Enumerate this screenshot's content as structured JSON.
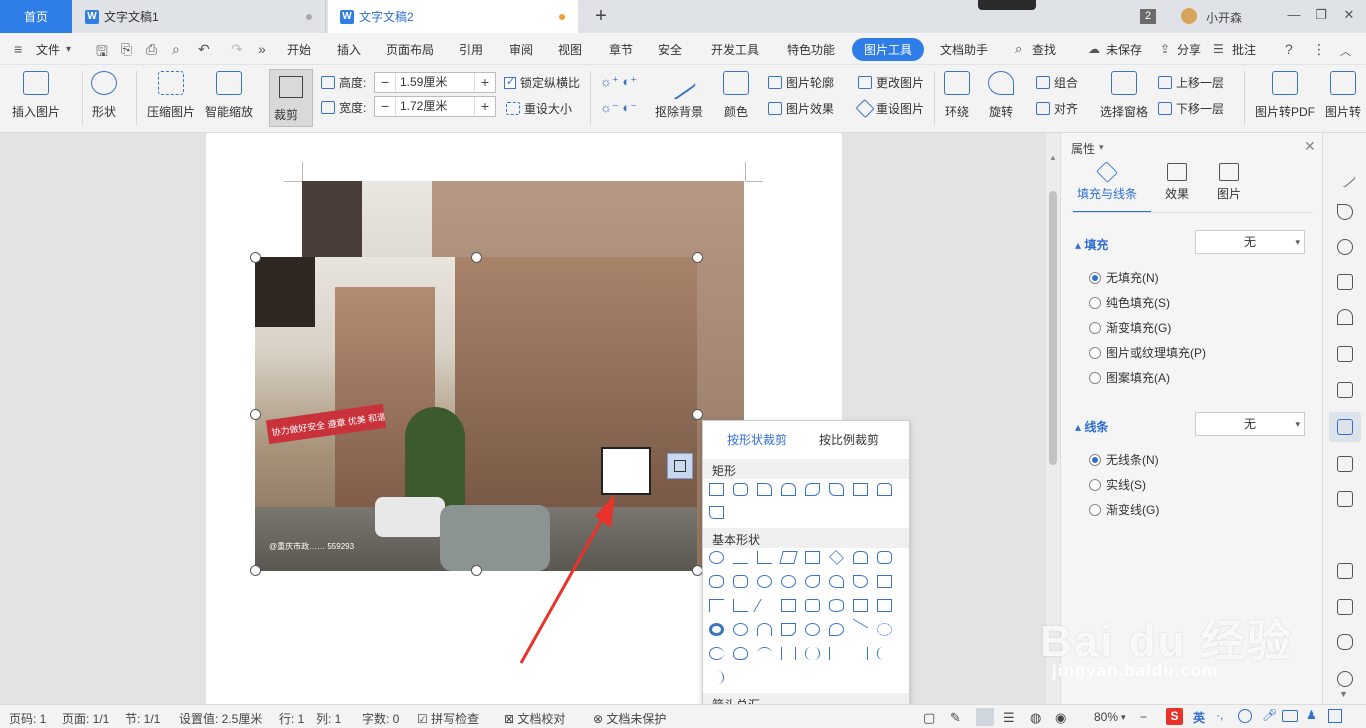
{
  "titlebar": {
    "home_tab": "首页",
    "doc_tab_1": "文字文稿1",
    "doc_tab_2": "文字文稿2",
    "window_count": "2",
    "user_name": "小开森"
  },
  "menubar": {
    "file": "文件",
    "items": [
      "开始",
      "插入",
      "页面布局",
      "引用",
      "审阅",
      "视图",
      "章节",
      "安全",
      "开发工具",
      "特色功能",
      "图片工具",
      "文档助手"
    ],
    "active_item": "图片工具",
    "search": "查找",
    "unsaved": "未保存",
    "share": "分享",
    "comment": "批注"
  },
  "ribbon": {
    "insert_picture": "插入图片",
    "shape": "形状",
    "compress": "压缩图片",
    "smart_scale": "智能缩放",
    "crop": "裁剪",
    "height_label": "高度:",
    "height_value": "1.59厘米",
    "width_label": "宽度:",
    "width_value": "1.72厘米",
    "lock_ratio": "锁定纵横比",
    "reset_size": "重设大小",
    "remove_bg": "抠除背景",
    "color": "颜色",
    "pic_outline": "图片轮廓",
    "pic_effect": "图片效果",
    "change_pic": "更改图片",
    "reset_pic": "重设图片",
    "wrap": "环绕",
    "rotate": "旋转",
    "group": "组合",
    "align": "对齐",
    "select_pane": "选择窗格",
    "bring_forward": "上移一层",
    "send_backward": "下移一层",
    "pic_to_pdf": "图片转PDF",
    "pic_more": "图片转"
  },
  "crop_menu": {
    "tab_shape": "按形状裁剪",
    "tab_ratio": "按比例裁剪",
    "section_rect": "矩形",
    "section_basic": "基本形状",
    "section_arrow": "箭头总汇"
  },
  "photo_banner": "协力做好安全 遵章 优美 和谐的文明小区",
  "photo_watermark": "@重庆市政…… 559293",
  "right_panel": {
    "title": "属性",
    "tabs": [
      "填充与线条",
      "效果",
      "图片"
    ],
    "fill_section": "填充",
    "fill_value": "无",
    "fill_options": [
      "无填充(N)",
      "纯色填充(S)",
      "渐变填充(G)",
      "图片或纹理填充(P)",
      "图案填充(A)"
    ],
    "line_section": "线条",
    "line_value": "无",
    "line_options": [
      "无线条(N)",
      "实线(S)",
      "渐变线(G)"
    ]
  },
  "statusbar": {
    "page_num": "页码: 1",
    "page_count": "页面: 1/1",
    "section": "节: 1/1",
    "setting": "设置值: 2.5厘米",
    "row": "行: 1",
    "col": "列: 1",
    "words": "字数: 0",
    "spell": "拼写检查",
    "proof": "文档校对",
    "protect": "文档未保护",
    "zoom": "80%"
  },
  "watermark": {
    "main": "Bai du 经验",
    "sub": "jingyan.baidu.com"
  },
  "colors": {
    "accent": "#2f7ee8",
    "arrow": "#e8322a"
  }
}
